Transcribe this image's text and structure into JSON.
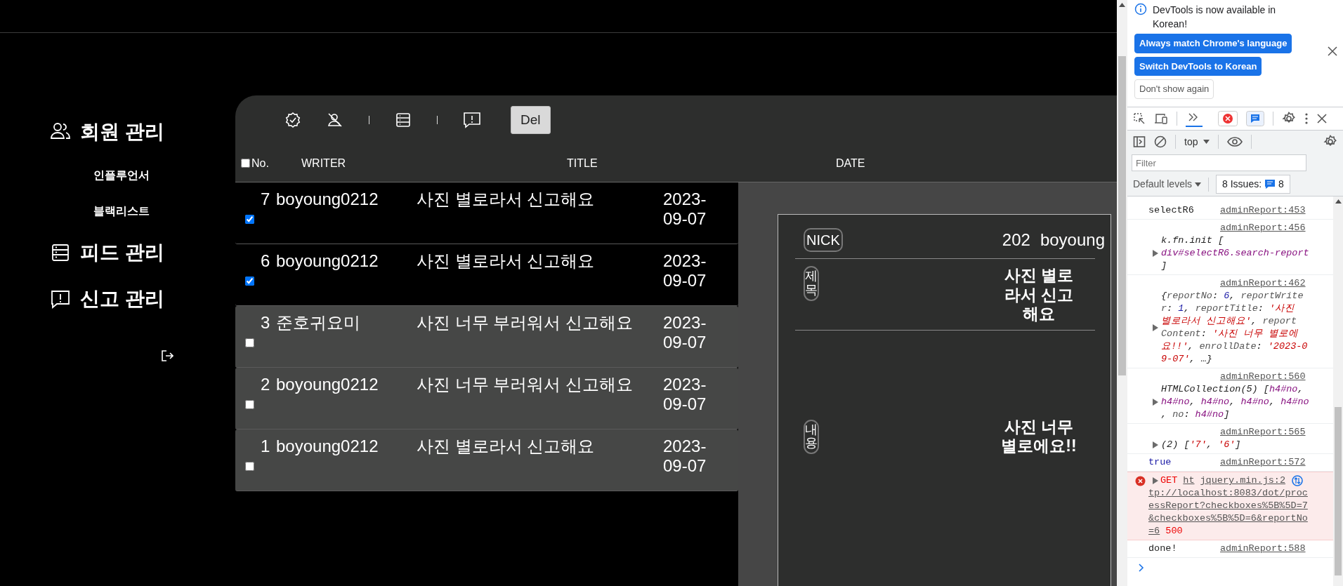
{
  "sidebar": {
    "menus": [
      {
        "label": "회원 관리",
        "kind": "members",
        "children": [
          {
            "label": "인플루언서"
          },
          {
            "label": "블랙리스트"
          }
        ]
      },
      {
        "label": "피드 관리",
        "kind": "feed"
      },
      {
        "label": "신고 관리",
        "kind": "report"
      }
    ]
  },
  "toolbar": {
    "delete_button": "Del"
  },
  "table": {
    "select_all": {
      "checked": false
    },
    "columns": [
      "No.",
      "WRITER",
      "TITLE",
      "DATE"
    ],
    "rows": [
      {
        "no": "7",
        "writer": "boyoung0212",
        "title": "사진 별로라서 신고해요",
        "date": "2023-09-07",
        "checked": true
      },
      {
        "no": "6",
        "writer": "boyoung0212",
        "title": "사진 별로라서 신고해요",
        "date": "2023-09-07",
        "checked": true
      },
      {
        "no": "3",
        "writer": "준호귀요미",
        "title": "사진 너무 부러워서 신고해요",
        "date": "2023-09-07",
        "checked": false
      },
      {
        "no": "2",
        "writer": "boyoung0212",
        "title": "사진 너무 부러워서 신고해요",
        "date": "2023-09-07",
        "checked": false
      },
      {
        "no": "1",
        "writer": "boyoung0212",
        "title": "사진 별로라서 신고해요",
        "date": "2023-09-07",
        "checked": false
      }
    ]
  },
  "detail": {
    "nick_label": "NICK",
    "date": "202",
    "writer": "boyoung",
    "title_label": "제목",
    "title": "사진 별로라서 신고해요",
    "content_label": "내용",
    "content": "사진 너무 별로에요!!"
  },
  "devtools": {
    "notice": {
      "message": "DevTools is now available in Korean!",
      "buttons": [
        {
          "label": "Always match Chrome's language",
          "kind": "primary"
        },
        {
          "label": "Switch DevTools to Korean",
          "kind": "primary"
        },
        {
          "label": "Don't show again",
          "kind": "secondary"
        }
      ]
    },
    "context": "top",
    "filter_placeholder": "Filter",
    "levels": "Default levels",
    "issues_label": "8 Issues:",
    "issues_count": "8",
    "console": [
      {
        "kind": "text",
        "source": "adminReport:453",
        "lines": [
          [
            {
              "text": "selectR6",
              "kind": "plain"
            }
          ]
        ]
      },
      {
        "kind": "object",
        "source": "adminReport:456",
        "lines": [
          [
            {
              "text": "k.fn.init [",
              "kind": "plain"
            }
          ],
          [
            {
              "text": "div#selectR6.search-report",
              "kind": "node"
            }
          ],
          [
            {
              "text": "]",
              "kind": "plain"
            }
          ]
        ]
      },
      {
        "kind": "object",
        "source": "adminReport:462",
        "lines": [
          [
            {
              "text": "{",
              "kind": "plain"
            },
            {
              "text": "reportNo",
              "kind": "key"
            },
            {
              "text": ": ",
              "kind": "plain"
            },
            {
              "text": "6",
              "kind": "num"
            },
            {
              "text": ", ",
              "kind": "plain"
            },
            {
              "text": "reportWrite",
              "kind": "key"
            }
          ],
          [
            {
              "text": "r",
              "kind": "key"
            },
            {
              "text": ": ",
              "kind": "plain"
            },
            {
              "text": "1",
              "kind": "num"
            },
            {
              "text": ", ",
              "kind": "plain"
            },
            {
              "text": "reportTitle",
              "kind": "key"
            },
            {
              "text": ": ",
              "kind": "plain"
            },
            {
              "text": "'사진",
              "kind": "str"
            }
          ],
          [
            {
              "text": "별로라서 신고해요'",
              "kind": "str"
            },
            {
              "text": ", ",
              "kind": "plain"
            },
            {
              "text": "report",
              "kind": "key"
            }
          ],
          [
            {
              "text": "Content",
              "kind": "key"
            },
            {
              "text": ": ",
              "kind": "plain"
            },
            {
              "text": "'사진 너무 별로에",
              "kind": "str"
            }
          ],
          [
            {
              "text": "요!!'",
              "kind": "str"
            },
            {
              "text": ", ",
              "kind": "plain"
            },
            {
              "text": "enrollDate",
              "kind": "key"
            },
            {
              "text": ": ",
              "kind": "plain"
            },
            {
              "text": "'2023-0",
              "kind": "str"
            }
          ],
          [
            {
              "text": "9-07'",
              "kind": "str"
            },
            {
              "text": ", …}",
              "kind": "plain"
            }
          ]
        ]
      },
      {
        "kind": "object",
        "source": "adminReport:560",
        "lines": [
          [
            {
              "text": "HTMLCollection(5) [",
              "kind": "plain"
            },
            {
              "text": "h4#no",
              "kind": "node"
            },
            {
              "text": ",",
              "kind": "plain"
            }
          ],
          [
            {
              "text": "h4#no",
              "kind": "node"
            },
            {
              "text": ", ",
              "kind": "plain"
            },
            {
              "text": "h4#no",
              "kind": "node"
            },
            {
              "text": ", ",
              "kind": "plain"
            },
            {
              "text": "h4#no",
              "kind": "node"
            },
            {
              "text": ", ",
              "kind": "plain"
            },
            {
              "text": "h4#no",
              "kind": "node"
            }
          ],
          [
            {
              "text": ", ",
              "kind": "plain"
            },
            {
              "text": "no",
              "kind": "key"
            },
            {
              "text": ": ",
              "kind": "plain"
            },
            {
              "text": "h4#no",
              "kind": "node"
            },
            {
              "text": "]",
              "kind": "plain"
            }
          ]
        ]
      },
      {
        "kind": "object",
        "source": "adminReport:565",
        "lines": [
          [
            {
              "text": "(2) [",
              "kind": "plain"
            },
            {
              "text": "'7'",
              "kind": "str"
            },
            {
              "text": ", ",
              "kind": "plain"
            },
            {
              "text": "'6'",
              "kind": "str"
            },
            {
              "text": "]",
              "kind": "plain"
            }
          ]
        ]
      },
      {
        "kind": "text",
        "source": "adminReport:572",
        "lines": [
          [
            {
              "text": "true",
              "kind": "bool"
            }
          ]
        ]
      },
      {
        "kind": "error",
        "source": "jquery.min.js:2",
        "lines": [
          [
            {
              "text": "GET",
              "kind": "err"
            },
            {
              "text": "ht",
              "kind": "link"
            }
          ],
          [
            {
              "text": "tp://localhost:8083/dot/proc",
              "kind": "link"
            }
          ],
          [
            {
              "text": "essReport?checkboxes%5B%5D=7",
              "kind": "link"
            }
          ],
          [
            {
              "text": "&checkboxes%5B%5D=6&reportNo",
              "kind": "link"
            }
          ],
          [
            {
              "text": "=6",
              "kind": "link"
            },
            {
              "text": " 500",
              "kind": "err"
            }
          ]
        ]
      },
      {
        "kind": "text",
        "source": "adminReport:588",
        "lines": [
          [
            {
              "text": "done!",
              "kind": "plain"
            }
          ]
        ]
      }
    ]
  }
}
